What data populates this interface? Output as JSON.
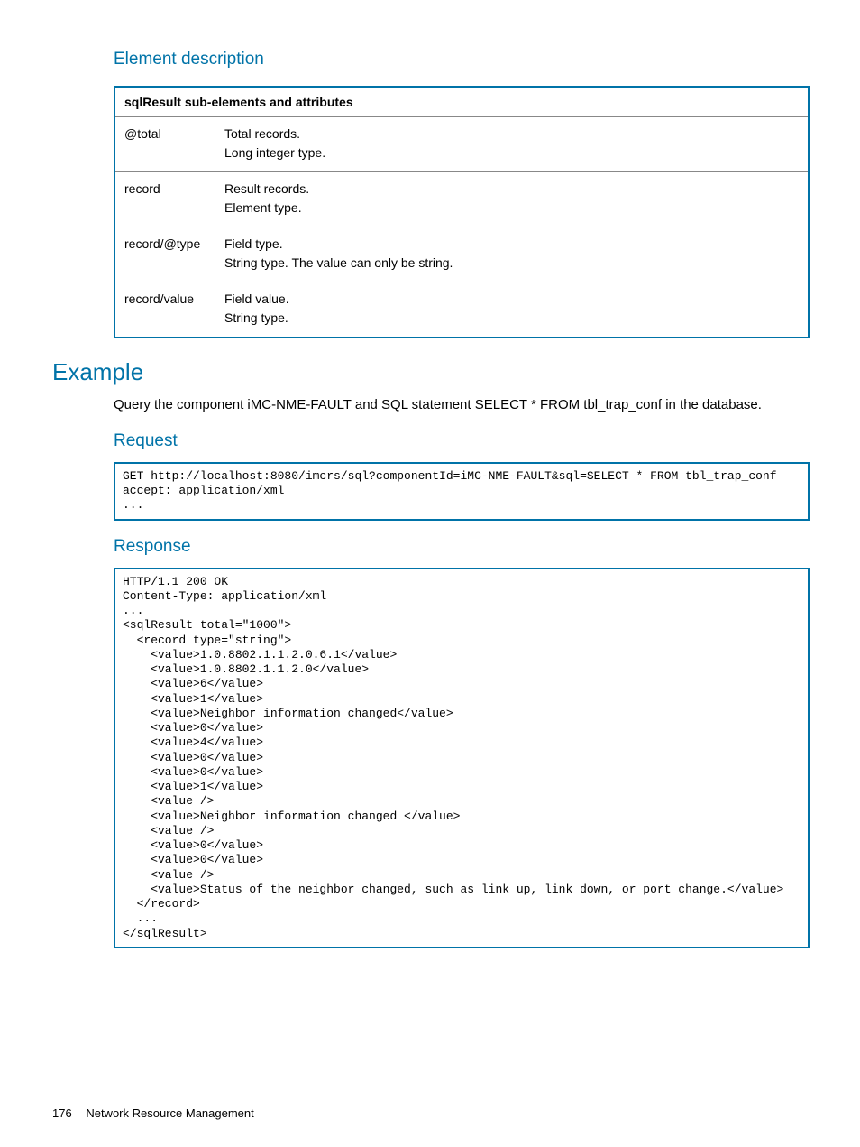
{
  "headings": {
    "element_description": "Element description",
    "example": "Example",
    "request": "Request",
    "response": "Response"
  },
  "table": {
    "header": "sqlResult sub-elements and attributes",
    "rows": [
      {
        "name": "@total",
        "desc": "Total records.\nLong integer type."
      },
      {
        "name": "record",
        "desc": "Result records.\nElement type."
      },
      {
        "name": "record/@type",
        "desc": "Field type.\nString type. The value can only be string."
      },
      {
        "name": "record/value",
        "desc": "Field value.\nString type."
      }
    ]
  },
  "example_intro": "Query the component iMC-NME-FAULT and SQL statement SELECT * FROM tbl_trap_conf in the database.",
  "request_code": "GET http://localhost:8080/imcrs/sql?componentId=iMC-NME-FAULT&sql=SELECT * FROM tbl_trap_conf\naccept: application/xml\n...",
  "response_code": "HTTP/1.1 200 OK\nContent-Type: application/xml\n...\n<sqlResult total=\"1000\">\n  <record type=\"string\">\n    <value>1.0.8802.1.1.2.0.6.1</value>\n    <value>1.0.8802.1.1.2.0</value>\n    <value>6</value>\n    <value>1</value>\n    <value>Neighbor information changed</value>\n    <value>0</value>\n    <value>4</value>\n    <value>0</value>\n    <value>0</value>\n    <value>1</value>\n    <value />\n    <value>Neighbor information changed </value>\n    <value />\n    <value>0</value>\n    <value>0</value>\n    <value />\n    <value>Status of the neighbor changed, such as link up, link down, or port change.</value>\n  </record>\n  ...\n</sqlResult>",
  "footer": {
    "page": "176",
    "title": "Network Resource Management"
  }
}
